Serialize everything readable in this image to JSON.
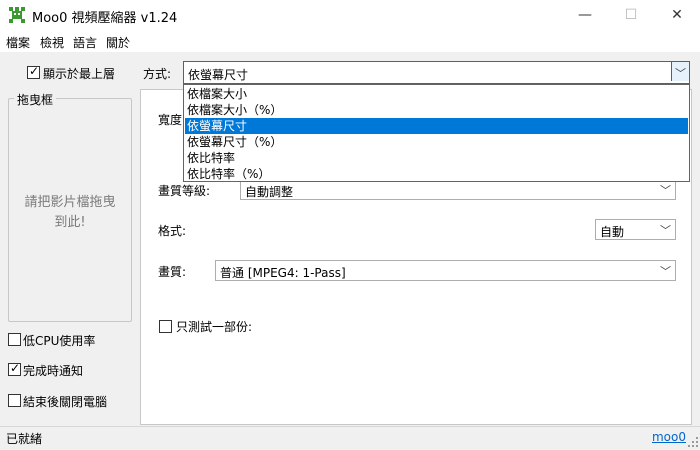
{
  "window": {
    "title": "Moo0 視頻壓縮器 v1.24",
    "minimize": "—",
    "maximize": "☐",
    "close": "✕",
    "app_icon": "moo0-icon"
  },
  "menu": [
    "檔案",
    "檢視",
    "語言",
    "關於"
  ],
  "left": {
    "always_on_top": {
      "label": "顯示於最上層",
      "checked": true
    },
    "drag_frame_title": "拖曳框",
    "drag_hint_line1": "請把影片檔拖曳",
    "drag_hint_line2": "到此!",
    "low_cpu": {
      "label": "低CPU使用率",
      "checked": false
    },
    "notify_done": {
      "label": "完成時通知",
      "checked": true
    },
    "shutdown_after": {
      "label": "結束後關閉電腦",
      "checked": false
    }
  },
  "main": {
    "method_label": "方式:",
    "method_value": "依螢幕尺寸",
    "method_options": [
      "依檔案大小",
      "依檔案大小（%）",
      "依螢幕尺寸",
      "依螢幕尺寸（%）",
      "依比特率",
      "依比特率（%）"
    ],
    "method_selected_index": 2,
    "width_label_partial": "寬度",
    "quality_level_label": "畫質等級:",
    "quality_level_value": "自動調整",
    "format_label": "格式:",
    "format_value": "自動",
    "quality_label": "畫質:",
    "quality_value": "普通   [MPEG4: 1-Pass]",
    "test_part": {
      "label": "只測試一部份:",
      "checked": false
    }
  },
  "status": {
    "text": "已就緒",
    "link": "moo0"
  },
  "colors": {
    "accent": "#0078d7",
    "link": "#0066cc"
  }
}
